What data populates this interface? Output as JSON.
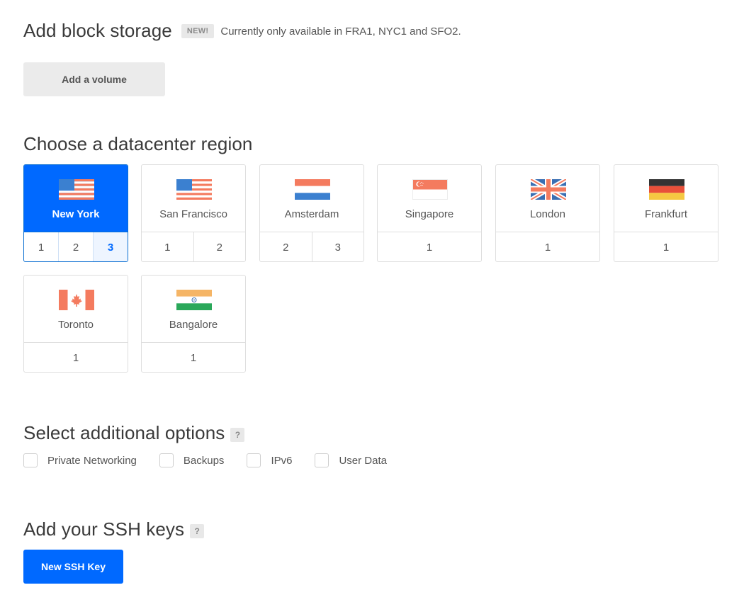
{
  "block_storage": {
    "title": "Add block storage",
    "badge": "NEW!",
    "note": "Currently only available in FRA1, NYC1 and SFO2.",
    "button_label": "Add a volume"
  },
  "region": {
    "title": "Choose a datacenter region",
    "cards": [
      {
        "name": "New York",
        "flag": "us-flag-icon",
        "numbers": [
          "1",
          "2",
          "3"
        ],
        "selected": true,
        "active_number": "3"
      },
      {
        "name": "San Francisco",
        "flag": "us-flag-icon",
        "numbers": [
          "1",
          "2"
        ]
      },
      {
        "name": "Amsterdam",
        "flag": "netherlands-flag-icon",
        "numbers": [
          "2",
          "3"
        ]
      },
      {
        "name": "Singapore",
        "flag": "singapore-flag-icon",
        "numbers": [
          "1"
        ]
      },
      {
        "name": "London",
        "flag": "uk-flag-icon",
        "numbers": [
          "1"
        ]
      },
      {
        "name": "Frankfurt",
        "flag": "germany-flag-icon",
        "numbers": [
          "1"
        ]
      },
      {
        "name": "Toronto",
        "flag": "canada-flag-icon",
        "numbers": [
          "1"
        ]
      },
      {
        "name": "Bangalore",
        "flag": "india-flag-icon",
        "numbers": [
          "1"
        ]
      }
    ]
  },
  "options": {
    "title": "Select additional options",
    "help": "?",
    "items": [
      {
        "label": "Private Networking",
        "checked": false
      },
      {
        "label": "Backups",
        "checked": false
      },
      {
        "label": "IPv6",
        "checked": false
      },
      {
        "label": "User Data",
        "checked": false
      }
    ]
  },
  "ssh": {
    "title": "Add your SSH keys",
    "help": "?",
    "button_label": "New SSH Key"
  },
  "colors": {
    "primary": "#0069ff",
    "selected_border": "#0a6ed1",
    "flag_red": "#f47b5f",
    "flag_blue": "#3b80d0",
    "flag_navy": "#3a6fb3"
  }
}
